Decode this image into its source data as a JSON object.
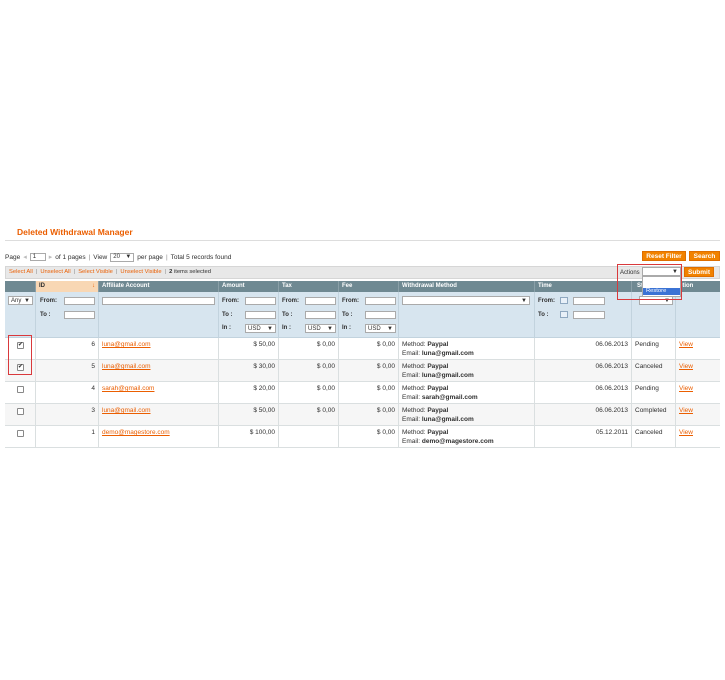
{
  "page_title": "Deleted Withdrawal Manager",
  "pager": {
    "page_label": "Page",
    "page_value": "1",
    "of_pages": "of 1 pages",
    "view_label": "View",
    "per_page_value": "20",
    "per_page_label": "per page",
    "total": "Total 5 records found"
  },
  "buttons": {
    "reset_filter": "Reset Filter",
    "search": "Search",
    "submit": "Submit"
  },
  "mass": {
    "select_all": "Select All",
    "unselect_all": "Unselect All",
    "select_visible": "Select Visible",
    "unselect_visible": "Unselect Visible",
    "selected_count": "2",
    "selected_suffix": "items selected",
    "sep": "|"
  },
  "actions": {
    "label": "Actions",
    "selected": "",
    "options": [
      "Restore"
    ]
  },
  "columns": {
    "id": "ID",
    "account": "Affiliate Account",
    "amount": "Amount",
    "tax": "Tax",
    "fee": "Fee",
    "method": "Withdrawal Method",
    "time": "Time",
    "status": "St",
    "action": "ction"
  },
  "filters": {
    "any": "Any",
    "from": "From:",
    "to": "To :",
    "from_tax": "From:",
    "in": "In :",
    "currency": "USD"
  },
  "method_prefix": "Method:",
  "email_prefix": "Email:",
  "view_label": "View",
  "rows": [
    {
      "checked": true,
      "id": "6",
      "account": "luna@gmail.com",
      "amount": "$ 50,00",
      "tax": "$ 0,00",
      "fee": "$ 0,00",
      "method": "Paypal",
      "email": "luna@gmail.com",
      "time": "06.06.2013",
      "status": "Pending"
    },
    {
      "checked": true,
      "id": "5",
      "account": "luna@gmail.com",
      "amount": "$ 30,00",
      "tax": "$ 0,00",
      "fee": "$ 0,00",
      "method": "Paypal",
      "email": "luna@gmail.com",
      "time": "06.06.2013",
      "status": "Canceled"
    },
    {
      "checked": false,
      "id": "4",
      "account": "sarah@gmail.com",
      "amount": "$ 20,00",
      "tax": "$ 0,00",
      "fee": "$ 0,00",
      "method": "Paypal",
      "email": "sarah@gmail.com",
      "time": "06.06.2013",
      "status": "Pending"
    },
    {
      "checked": false,
      "id": "3",
      "account": "luna@gmail.com",
      "amount": "$ 50,00",
      "tax": "$ 0,00",
      "fee": "$ 0,00",
      "method": "Paypal",
      "email": "luna@gmail.com",
      "time": "06.06.2013",
      "status": "Completed"
    },
    {
      "checked": false,
      "id": "1",
      "account": "demo@magestore.com",
      "amount": "$ 100,00",
      "tax": "",
      "fee": "$ 0,00",
      "method": "Paypal",
      "email": "demo@magestore.com",
      "time": "05.12.2011",
      "status": "Canceled"
    }
  ],
  "colors": {
    "accent": "#eb5e00",
    "button": "#f18200",
    "header": "#6f8992",
    "filter_bg": "#d7e5ef",
    "highlight_box": "#d9393c"
  }
}
